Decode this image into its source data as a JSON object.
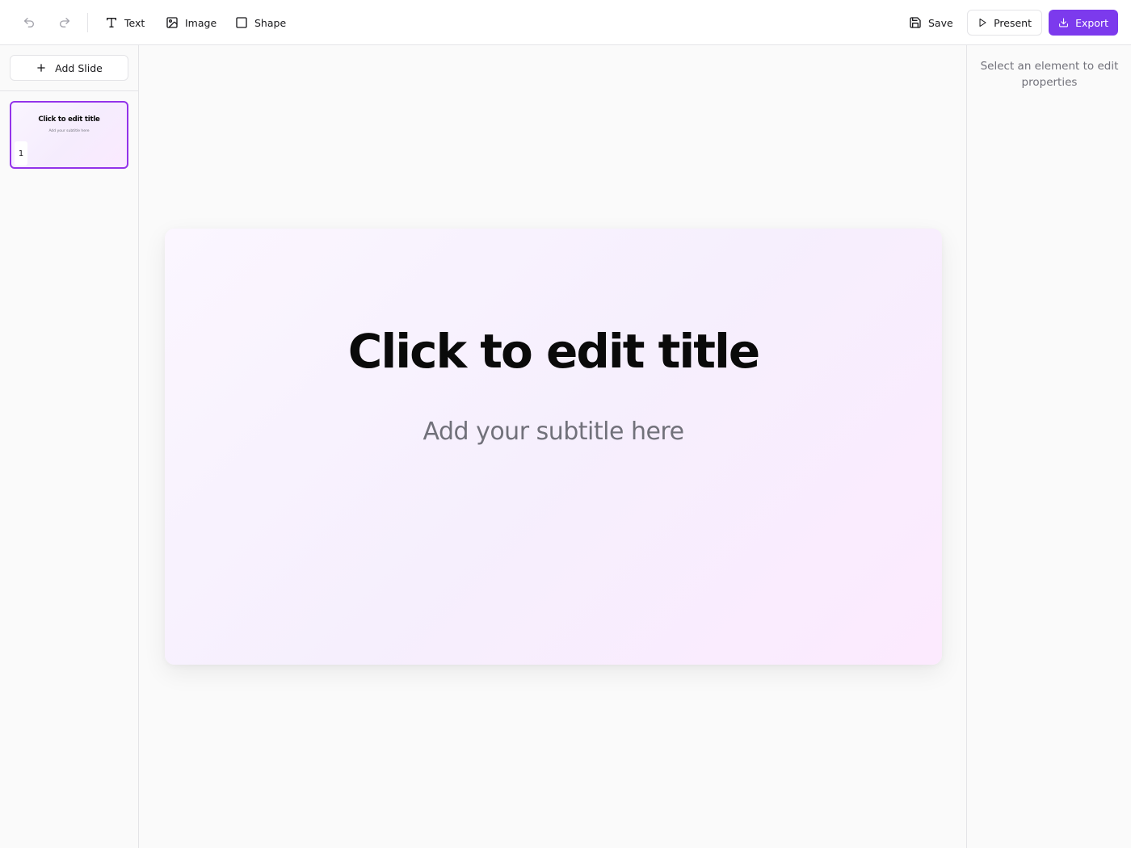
{
  "toolbar": {
    "undo_icon": "undo-icon",
    "redo_icon": "redo-icon",
    "text_label": "Text",
    "image_label": "Image",
    "shape_label": "Shape",
    "save_label": "Save",
    "present_label": "Present",
    "export_label": "Export"
  },
  "sidebar": {
    "add_slide_label": "Add Slide",
    "slides": [
      {
        "number": "1",
        "title": "Click to edit title",
        "subtitle": "Add your subtitle here",
        "selected": true
      }
    ]
  },
  "slide": {
    "title": "Click to edit title",
    "subtitle": "Add your subtitle here"
  },
  "properties": {
    "hint": "Select an element to edit properties"
  },
  "colors": {
    "accent": "#7c3aed",
    "selection": "#9333ea",
    "border": "#e4e4e7",
    "muted_text": "#71717a"
  }
}
